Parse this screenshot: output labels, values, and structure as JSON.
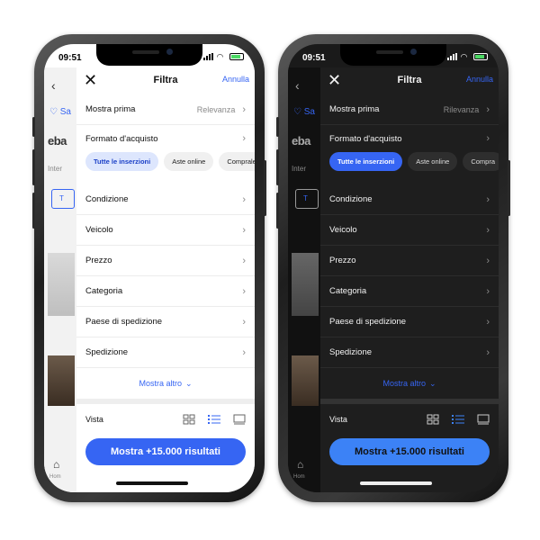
{
  "phones": [
    {
      "theme": "light",
      "status": {
        "time": "09:51"
      },
      "background_app": {
        "logo": "eba",
        "interest_snippet": "Inter",
        "tab_snippet": "T",
        "home_label": "Hom",
        "heart_label": "♡ Sa"
      },
      "filter": {
        "title": "Filtra",
        "cancel_label": "Annulla",
        "sort": {
          "label": "Mostra prima",
          "value": "Relevanza"
        },
        "purchase_format_label": "Formato d'acquisto",
        "chips": [
          "Tutte le inserzioni",
          "Aste online",
          "Comprale"
        ],
        "rows": [
          "Condizione",
          "Veicolo",
          "Prezzo",
          "Categoria",
          "Paese di spedizione",
          "Spedizione"
        ],
        "show_more": "Mostra altro",
        "view_label": "Vista",
        "cta": "Mostra +15.000 risultati"
      }
    },
    {
      "theme": "dark",
      "status": {
        "time": "09:51"
      },
      "background_app": {
        "logo": "eba",
        "interest_snippet": "Inter",
        "tab_snippet": "T",
        "home_label": "Hom",
        "heart_label": "♡ Sa"
      },
      "filter": {
        "title": "Filtra",
        "cancel_label": "Annulla",
        "sort": {
          "label": "Mostra prima",
          "value": "Rilevanza"
        },
        "purchase_format_label": "Formato d'acquisto",
        "chips": [
          "Tutte le inserzioni",
          "Aste online",
          "Compra"
        ],
        "rows": [
          "Condizione",
          "Veicolo",
          "Prezzo",
          "Categoria",
          "Paese di spedizione",
          "Spedizione"
        ],
        "show_more": "Mostra altro",
        "view_label": "Vista",
        "cta": "Mostra +15.000 risultati"
      }
    }
  ],
  "colors": {
    "accent": "#3665f3",
    "accent_dark_mode": "#3c82f6"
  },
  "icons": {
    "close": "close-icon",
    "chevron": "chevron-right-icon",
    "grid_view": "grid-view-icon",
    "list_view": "list-view-icon",
    "gallery_view": "gallery-view-icon"
  }
}
